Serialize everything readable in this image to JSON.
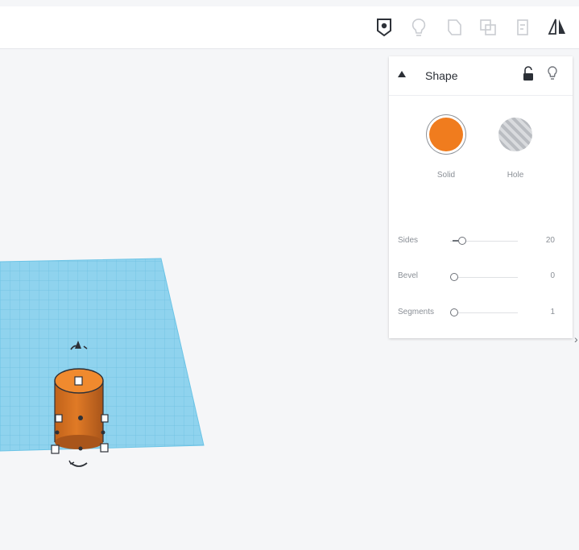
{
  "toolbar": {
    "icons": [
      "note-pin-icon",
      "light-bulb-icon",
      "group-icon",
      "ungroup-icon",
      "align-icon",
      "mirror-icon"
    ]
  },
  "panel": {
    "title": "Shape",
    "solid_label": "Solid",
    "hole_label": "Hole",
    "params": [
      {
        "label": "Sides",
        "value": "20"
      },
      {
        "label": "Bevel",
        "value": "0"
      },
      {
        "label": "Segments",
        "value": "1"
      }
    ]
  },
  "colors": {
    "shape_orange": "#f07c1e",
    "workplane_blue": "#8fd3ee",
    "grid_line": "#5fb6dc"
  }
}
